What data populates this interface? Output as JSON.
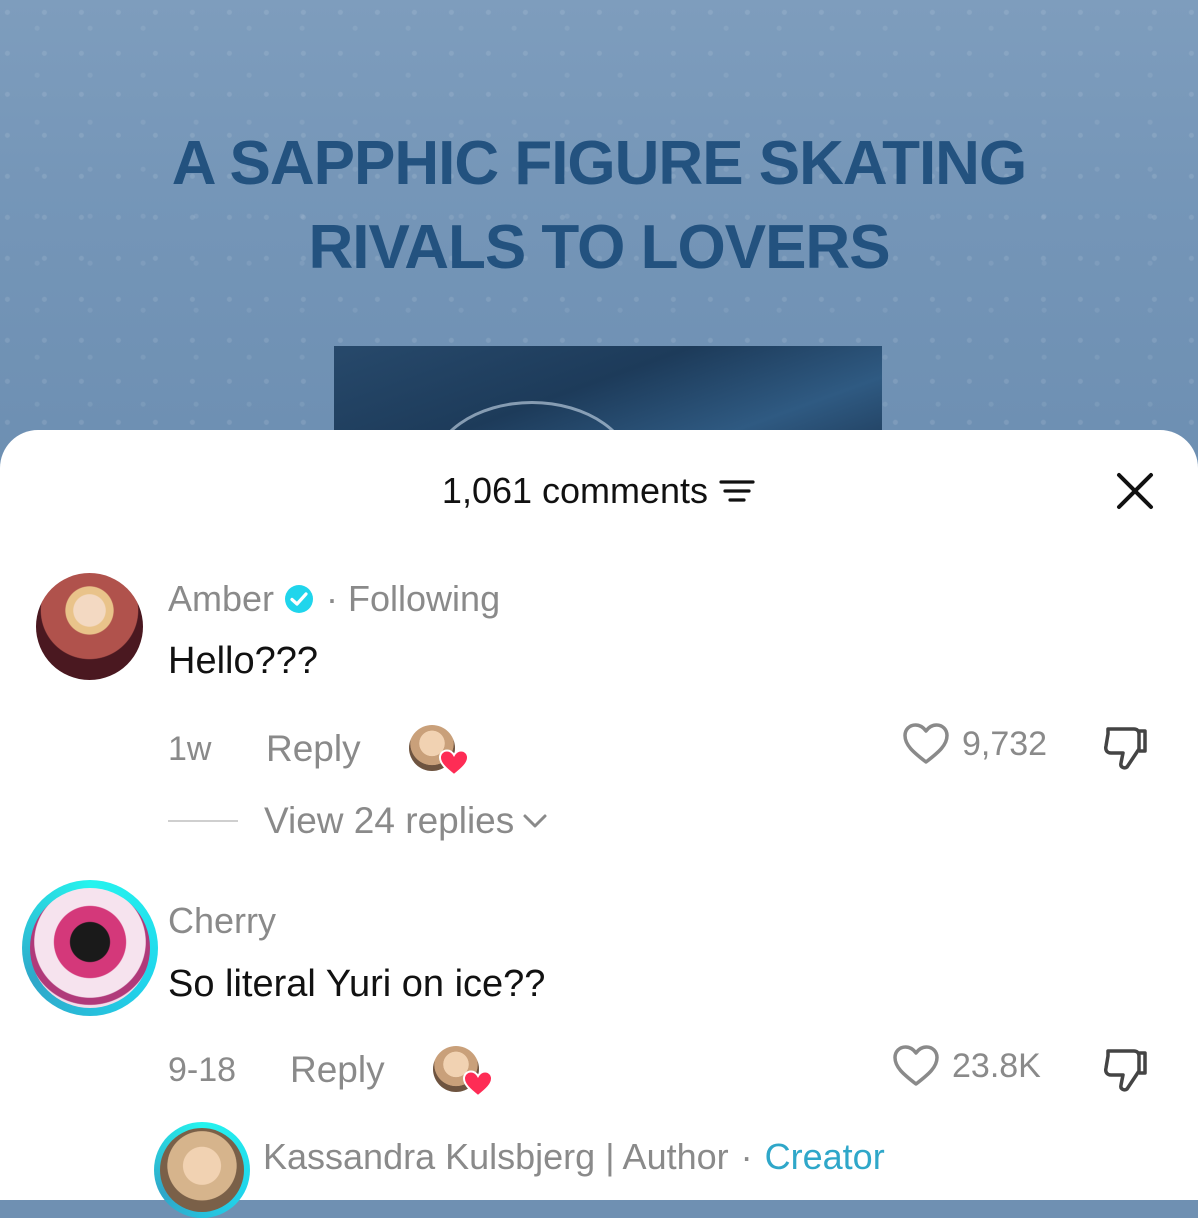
{
  "video": {
    "title_lines": [
      "A SAPPHIC FIGURE SKATING",
      "RIVALS TO LOVERS"
    ]
  },
  "sheet": {
    "comment_count": "1,061 comments",
    "sort_icon": "filter-lines-icon",
    "close_icon": "close-icon"
  },
  "comments": [
    {
      "username": "Amber",
      "verified": true,
      "separator": "·",
      "relation": "Following",
      "text": "Hello???",
      "time": "1w",
      "reply_label": "Reply",
      "likes": "9,732",
      "view_replies": "View 24 replies"
    },
    {
      "username": "Cherry",
      "text": "So literal Yuri on ice??",
      "time": "9-18",
      "reply_label": "Reply",
      "likes": "23.8K"
    }
  ],
  "reply_preview": {
    "username": "Kassandra Kulsbjerg | Author",
    "separator": "·",
    "badge": "Creator"
  },
  "colors": {
    "accent": "#2fa7c9",
    "heart": "#fe2c55",
    "muted_text": "#8a8a8a",
    "verified": "#20d5ec"
  }
}
